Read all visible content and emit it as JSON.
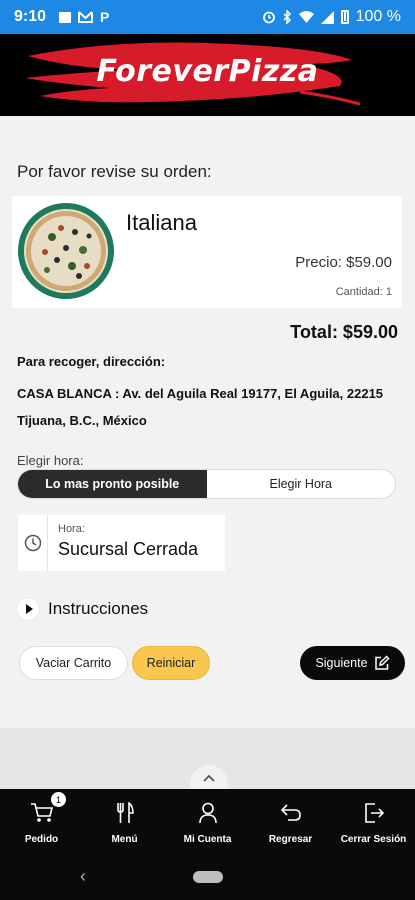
{
  "status_bar": {
    "time": "9:10",
    "battery": "100 %"
  },
  "brand": {
    "logo_text": "ForeverPizza",
    "accent_color": "#d81b2a"
  },
  "order": {
    "heading": "Por favor revise su orden:",
    "item": {
      "name": "Italiana",
      "price": "Precio: $59.00",
      "quantity": "Cantidad: 1"
    },
    "total": "Total: $59.00",
    "pickup_label": "Para recoger, dirección:",
    "pickup_address": "CASA BLANCA : Av. del Aguila Real 19177, El Aguila, 22215 Tijuana, B.C., México"
  },
  "time_selection": {
    "label": "Elegir hora:",
    "options": [
      "Lo mas pronto posible",
      "Elegir Hora"
    ],
    "selected": "Lo mas pronto posible",
    "field_label": "Hora:",
    "field_value": "Sucursal Cerrada"
  },
  "instructions": {
    "label": "Instrucciones"
  },
  "actions": {
    "clear_cart": "Vaciar Carrito",
    "reset": "Reiniciar",
    "next": "Siguiente"
  },
  "bottom_nav": {
    "items": [
      {
        "label": "Pedido",
        "icon": "cart-icon",
        "badge": "1"
      },
      {
        "label": "Menú",
        "icon": "utensils-icon"
      },
      {
        "label": "Mi Cuenta",
        "icon": "user-icon"
      },
      {
        "label": "Regresar",
        "icon": "return-arrow-icon"
      },
      {
        "label": "Cerrar Sesión",
        "icon": "logout-icon"
      }
    ]
  }
}
